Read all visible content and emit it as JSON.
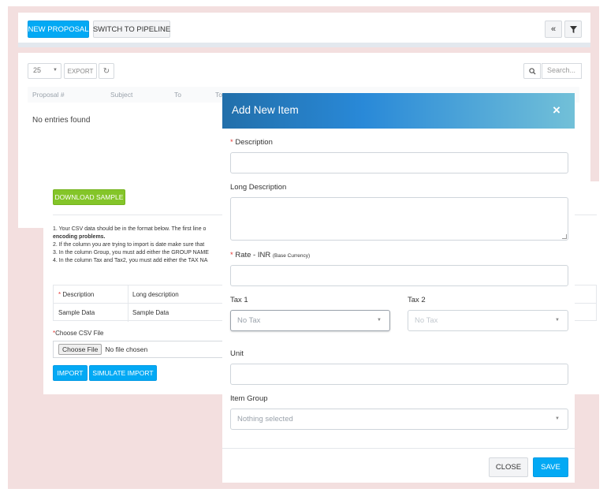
{
  "toolbar": {
    "new_proposal": "NEW PROPOSAL",
    "switch_pipeline": "SWITCH TO PIPELINE",
    "collapse_glyph": "«"
  },
  "table": {
    "page_length": "25",
    "export_label": "EXPORT",
    "search_placeholder": "Search...",
    "columns": [
      "Proposal #",
      "Subject",
      "To",
      "To"
    ],
    "empty_text": "No entries found"
  },
  "import": {
    "download_sample": "DOWNLOAD SAMPLE",
    "instructions": [
      "1. Your CSV data should be in the format below. The first line o",
      "encoding problems.",
      "2. If the column you are trying to import is date make sure that",
      "3. In the column Group, you must add either the GROUP NAME",
      "4. In the column Tax and Tax2, you must add either the TAX NA"
    ],
    "headers": [
      "Description",
      "Long description"
    ],
    "sample_row": [
      "Sample Data",
      "Sample Data"
    ],
    "choose_label": "Choose CSV File",
    "choose_button": "Choose File",
    "no_file": "No file chosen",
    "import_button": "IMPORT",
    "simulate_button": "SIMULATE IMPORT"
  },
  "modal": {
    "title": "Add New Item",
    "close_glyph": "×",
    "description_label": "Description",
    "long_description_label": "Long Description",
    "rate_label": "Rate - INR",
    "rate_sub": "(Base Currency)",
    "tax1_label": "Tax 1",
    "tax2_label": "Tax 2",
    "tax1_value": "No Tax",
    "tax2_value": "No Tax",
    "unit_label": "Unit",
    "item_group_label": "Item Group",
    "item_group_value": "Nothing selected",
    "close_button": "CLOSE",
    "save_button": "SAVE"
  },
  "colors": {
    "primary": "#03a9f4",
    "success": "#84c529",
    "header_start": "#226faa",
    "header_end": "#72c0d8",
    "background": "#f3dfdf"
  }
}
